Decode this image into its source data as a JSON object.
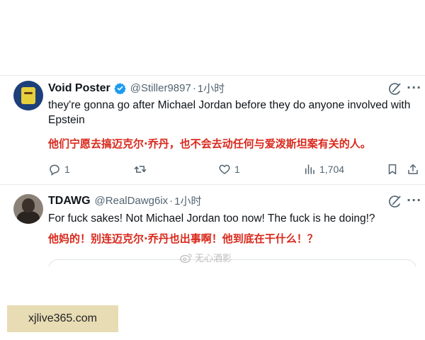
{
  "posts": [
    {
      "display_name": "Void Poster",
      "verified": true,
      "handle": "@Stiller9897",
      "separator": "·",
      "time": "1小时",
      "text_en": "they're gonna go after Michael Jordan before they do anyone involved with Epstein",
      "text_zh": "他们宁愿去搞迈克尔·乔丹，也不会去动任何与爱泼斯坦案有关的人。",
      "actions": {
        "replies": "1",
        "reposts": "",
        "likes": "1",
        "views": "1,704"
      },
      "icons": [
        "grok-icon",
        "more-icon",
        "reply-icon",
        "repost-icon",
        "like-icon",
        "views-icon",
        "bookmark-icon",
        "share-icon"
      ]
    },
    {
      "display_name": "TDAWG",
      "verified": false,
      "handle": "@RealDawg6ix",
      "separator": "·",
      "time": "1小时",
      "text_en": "For fuck sakes! Not Michael Jordan too now! The fuck is he doing!?",
      "text_zh": "他妈的！别连迈克尔·乔丹也出事啊！他到底在干什么！？",
      "icons": [
        "grok-icon",
        "more-icon"
      ]
    }
  ],
  "watermark": {
    "text": "无心酒影",
    "icon": "weibo-icon"
  },
  "site_badge": {
    "text": "xjlive365.com"
  },
  "colors": {
    "verified_blue": "#1d9bf0",
    "translation_red": "#d9291c",
    "muted_gray": "#536471",
    "badge_bg": "#e8dcb5"
  }
}
